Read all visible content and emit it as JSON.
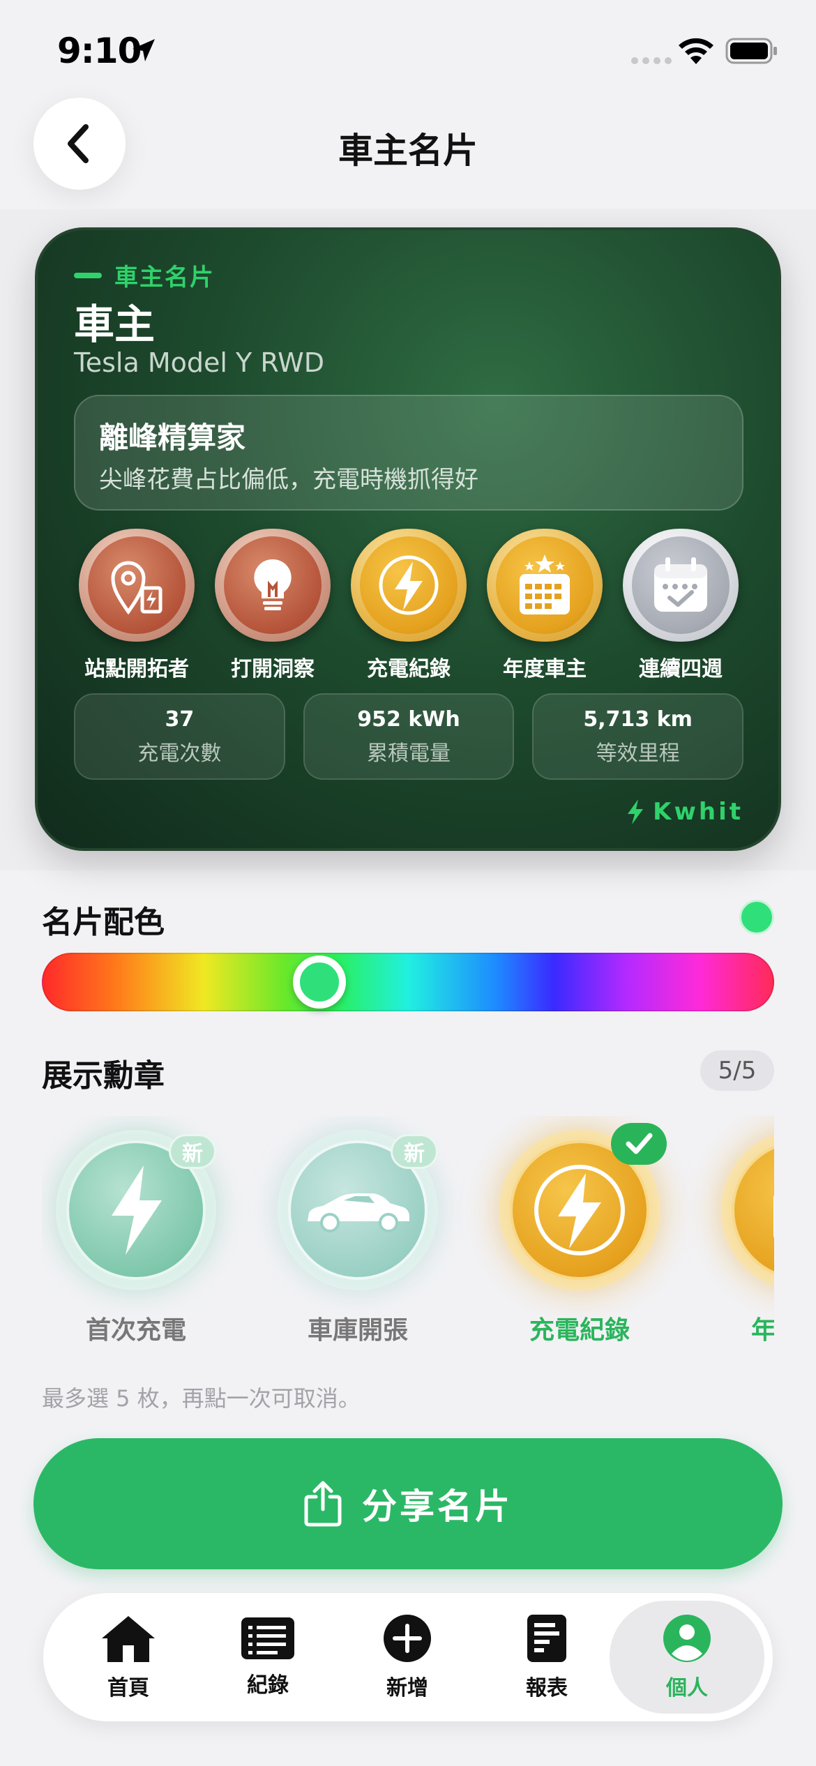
{
  "status": {
    "time": "9:10"
  },
  "header": {
    "title": "車主名片"
  },
  "card": {
    "tag": "車主名片",
    "role": "車主",
    "car": "Tesla Model Y RWD",
    "persona_title": "離峰精算家",
    "persona_desc": "尖峰花費占比偏低，充電時機抓得好",
    "badges": [
      {
        "label": "站點開拓者",
        "tier": "bronze",
        "icon": "map-pin-charger-icon"
      },
      {
        "label": "打開洞察",
        "tier": "bronze",
        "icon": "lightbulb-icon"
      },
      {
        "label": "充電紀錄",
        "tier": "gold",
        "icon": "lightning-bolt-icon"
      },
      {
        "label": "年度車主",
        "tier": "gold",
        "icon": "calendar-stars-icon"
      },
      {
        "label": "連續四週",
        "tier": "silver",
        "icon": "calendar-check-icon"
      }
    ],
    "stats": [
      {
        "value": "37",
        "label": "充電次數"
      },
      {
        "value": "952 kWh",
        "label": "累積電量"
      },
      {
        "value": "5,713 km",
        "label": "等效里程"
      }
    ],
    "brand": "Kwhit"
  },
  "color_section": {
    "title": "名片配色",
    "selected_color": "#2fe07a"
  },
  "medals_section": {
    "title": "展示勳章",
    "count": "5/5",
    "medals": [
      {
        "label": "首次充電",
        "new_label": "新",
        "style": "teal",
        "selected": false
      },
      {
        "label": "車庫開張",
        "new_label": "新",
        "style": "teal",
        "selected": false
      },
      {
        "label": "充電紀錄",
        "new_label": "",
        "style": "gold",
        "selected": true
      },
      {
        "label": "年度車主",
        "new_label": "",
        "style": "gold",
        "selected": true
      }
    ],
    "hint": "最多選 5 枚，再點一次可取消。"
  },
  "share_button": {
    "label": "分享名片"
  },
  "tabbar": {
    "tabs": [
      {
        "label": "首頁",
        "icon": "home-icon",
        "active": false
      },
      {
        "label": "紀錄",
        "icon": "list-icon",
        "active": false
      },
      {
        "label": "新增",
        "icon": "plus-circle-icon",
        "active": false
      },
      {
        "label": "報表",
        "icon": "report-icon",
        "active": false
      },
      {
        "label": "個人",
        "icon": "person-icon",
        "active": true
      }
    ]
  },
  "colors": {
    "accent": "#2bb866",
    "card_bg": "#1d4a2d",
    "gold": "#e4a11e"
  }
}
